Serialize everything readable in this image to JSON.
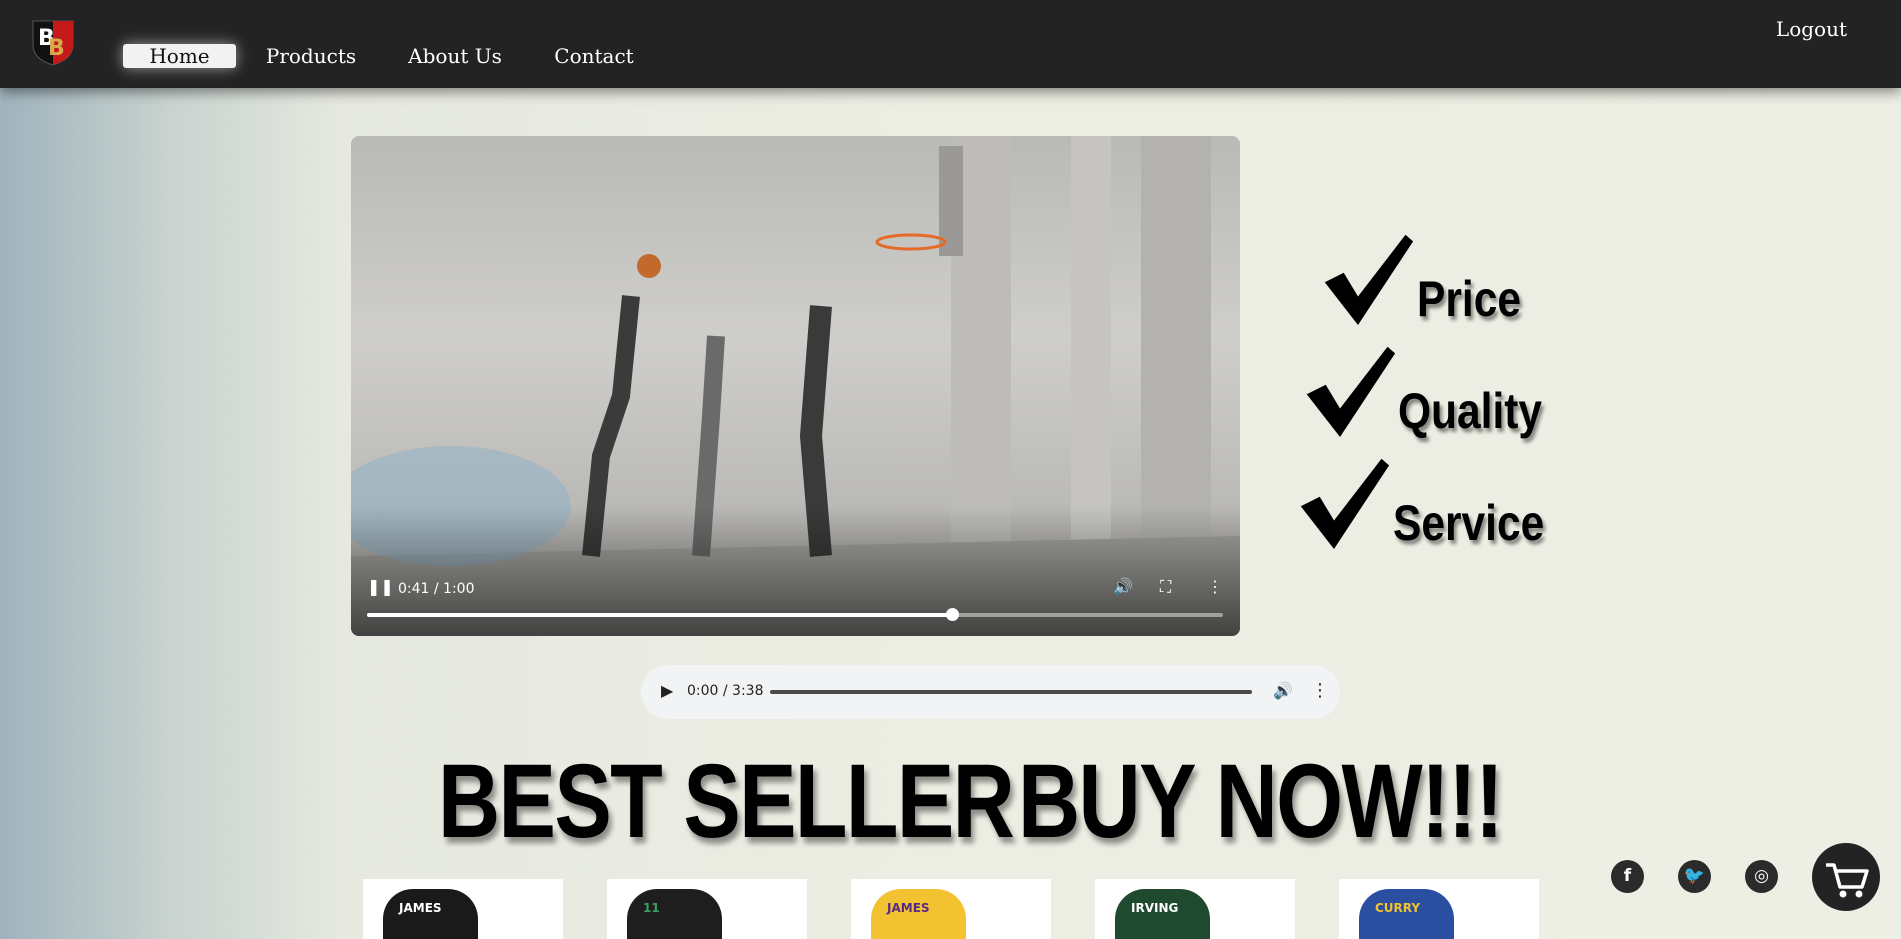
{
  "nav": {
    "logo_text": "BB",
    "links": [
      "Home",
      "Products",
      "About Us",
      "Contact"
    ],
    "logout": "Logout"
  },
  "video": {
    "time": "0:41 / 1:00",
    "progress": 0.683
  },
  "features": [
    "Price",
    "Quality",
    "Service"
  ],
  "audio": {
    "time": "0:00 / 3:38"
  },
  "banner": {
    "left": "BEST SELLER",
    "right": "BUY NOW!!!"
  },
  "products": [
    {
      "label": "JAMES",
      "color": "#1a1a1a"
    },
    {
      "label": "11",
      "color": "#1e1e1e"
    },
    {
      "label": "JAMES",
      "color": "#f2c230"
    },
    {
      "label": "IRVING",
      "color": "#1f4a30"
    },
    {
      "label": "CURRY",
      "color": "#2a4fa0"
    }
  ],
  "social": [
    "facebook-icon",
    "twitter-icon",
    "instagram-icon"
  ],
  "colors": {
    "nav_bg": "#232323",
    "text_dark": "#000000"
  }
}
